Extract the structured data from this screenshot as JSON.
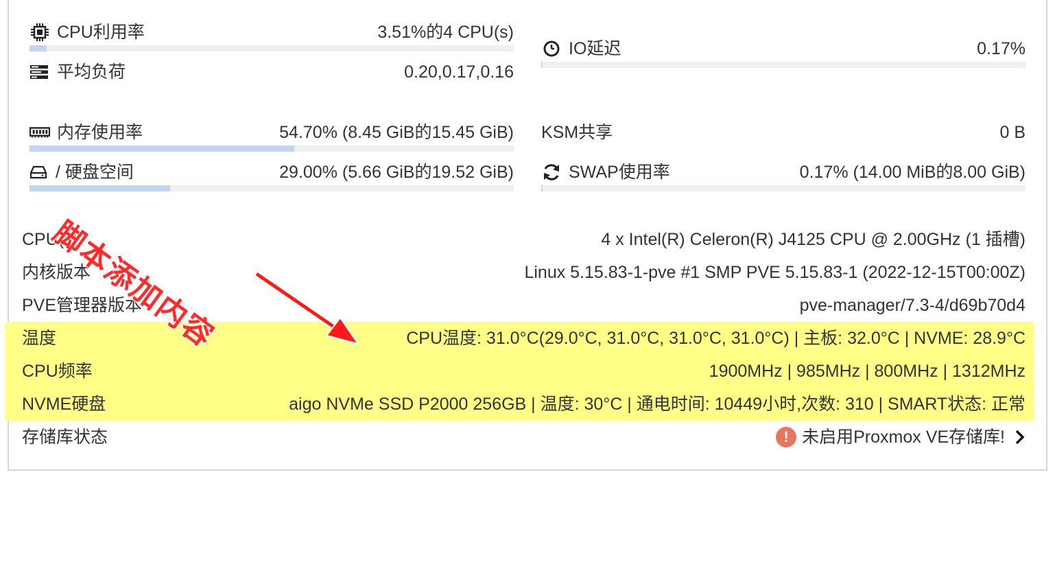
{
  "stats": {
    "cpu": {
      "label": "CPU利用率",
      "value": "3.51%的4 CPU(s)",
      "usage": 0.0351
    },
    "load": {
      "label": "平均负荷",
      "value": "0.20,0.17,0.16"
    },
    "io": {
      "label": "IO延迟",
      "value": "0.17%",
      "usage": 0.0017
    },
    "mem": {
      "label": "内存使用率",
      "value": "54.70% (8.45 GiB的15.45 GiB)",
      "usage": 0.547
    },
    "ksm": {
      "label": "KSM共享",
      "value": "0 B"
    },
    "disk": {
      "label": "/ 硬盘空间",
      "value": "29.00% (5.66 GiB的19.52 GiB)",
      "usage": 0.29
    },
    "swap": {
      "label": "SWAP使用率",
      "value": "0.17% (14.00 MiB的8.00 GiB)",
      "usage": 0.0017
    }
  },
  "info": {
    "cpus": {
      "label": "CPU(s)",
      "value": "4 x Intel(R) Celeron(R) J4125 CPU @ 2.00GHz (1 插槽)"
    },
    "kernel": {
      "label": "内核版本",
      "value": "Linux 5.15.83-1-pve #1 SMP PVE 5.15.83-1 (2022-12-15T00:00Z)"
    },
    "pve": {
      "label": "PVE管理器版本",
      "value": "pve-manager/7.3-4/d69b70d4"
    },
    "temp": {
      "label": "温度",
      "value": "CPU温度: 31.0°C(29.0°C, 31.0°C, 31.0°C, 31.0°C) | 主板: 32.0°C | NVME: 28.9°C"
    },
    "freq": {
      "label": "CPU频率",
      "value": "1900MHz | 985MHz | 800MHz | 1312MHz"
    },
    "nvme": {
      "label": "NVME硬盘",
      "value": "aigo NVMe SSD P2000 256GB | 温度: 30°C | 通电时间: 10449小时,次数: 310 | SMART状态: 正常"
    },
    "repo": {
      "label": "存储库状态",
      "value": "未启用Proxmox VE存储库!"
    }
  },
  "annotation": {
    "text": "脚本添加内容"
  },
  "colors": {
    "highlight": "#ffff88",
    "bar_fill": "#c3d6ee",
    "bar_bg": "#f0f0f0",
    "annotation": "#ff2a2a",
    "warning": "#e8765d"
  },
  "icons": {
    "cpu": "cpu-chip-icon",
    "load": "tasks-icon",
    "io": "clock-icon",
    "mem": "memory-icon",
    "disk": "hdd-icon",
    "swap": "refresh-icon",
    "repo_status": "exclamation-circle-icon",
    "repo_more": "chevron-right-icon"
  }
}
